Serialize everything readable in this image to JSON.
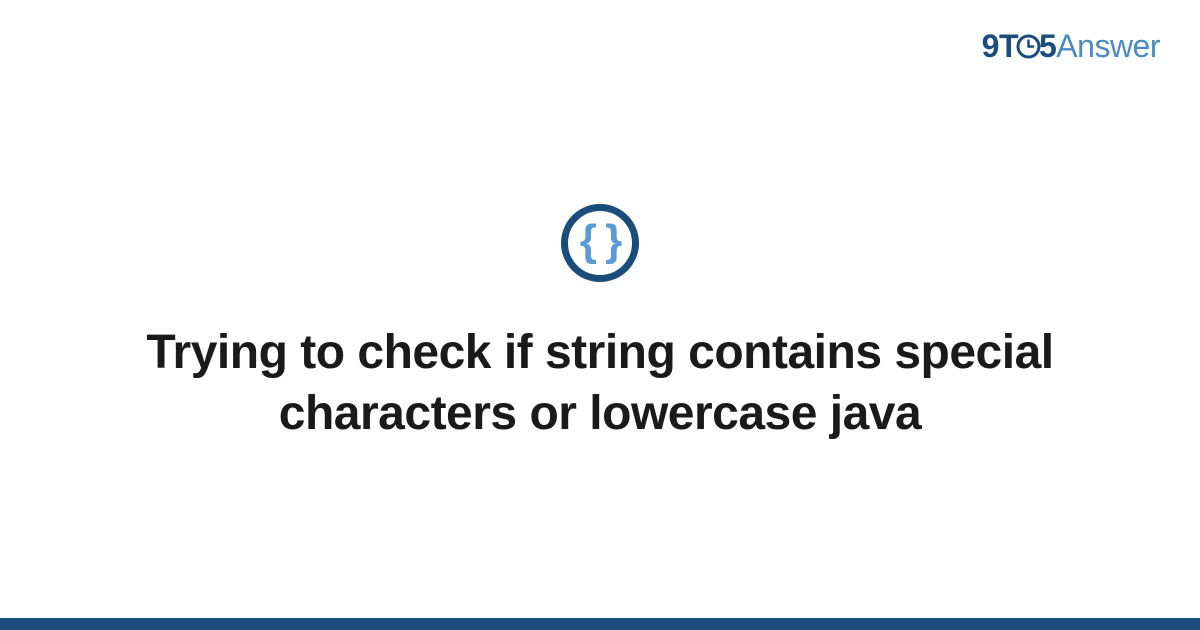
{
  "brand": {
    "part1": "9",
    "part2": "T",
    "part3": "5",
    "part4": "Answer"
  },
  "icon": {
    "braces": "{ }"
  },
  "title": "Trying to check if string contains special characters or lowercase java",
  "colors": {
    "primary": "#1a4d7a",
    "accent": "#5b9bd5",
    "logo_light": "#4a8bc2"
  }
}
